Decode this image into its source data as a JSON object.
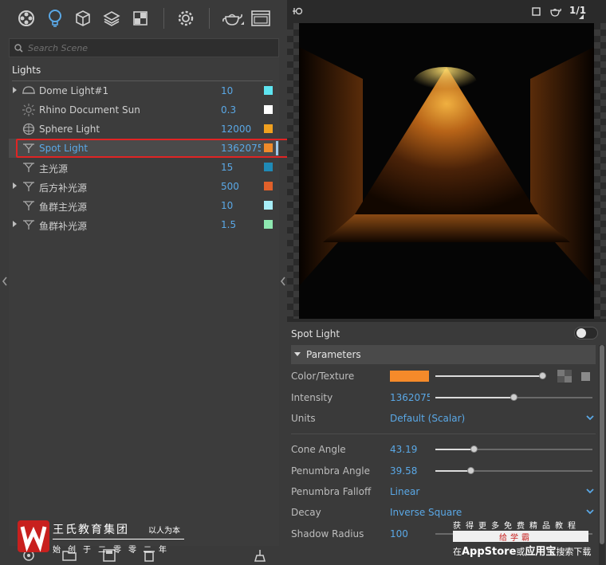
{
  "search": {
    "placeholder": "Search Scene"
  },
  "lights_header": "Lights",
  "lights": [
    {
      "name": "Dome Light#1",
      "value": "10",
      "color": "#5ee4f0",
      "expandable": true,
      "icon": "dome-light-icon"
    },
    {
      "name": "Rhino Document Sun",
      "value": "0.3",
      "color": "#ffffff",
      "expandable": false,
      "icon": "sun-icon"
    },
    {
      "name": "Sphere Light",
      "value": "12000",
      "color": "#f0a020",
      "expandable": false,
      "icon": "sphere-light-icon"
    },
    {
      "name": "Spot Light",
      "value": "1362075",
      "color": "#f08a2a",
      "expandable": false,
      "icon": "spot-light-icon",
      "selected": true
    },
    {
      "name": "主光源",
      "value": "15",
      "color": "#1f8ab6",
      "expandable": false,
      "icon": "spot-light-icon"
    },
    {
      "name": "后方补光源",
      "value": "500",
      "color": "#e0602a",
      "expandable": true,
      "icon": "spot-light-icon"
    },
    {
      "name": "鱼群主光源",
      "value": "10",
      "color": "#a8eef8",
      "expandable": false,
      "icon": "spot-light-icon"
    },
    {
      "name": "鱼群补光源",
      "value": "1.5",
      "color": "#8ee8b0",
      "expandable": true,
      "icon": "spot-light-icon"
    }
  ],
  "render_top": {
    "resolution_label": "1/1"
  },
  "properties": {
    "title": "Spot Light",
    "enabled": false,
    "section": "Parameters",
    "color_texture": {
      "label": "Color/Texture",
      "color": "#f58a2a",
      "slider": 0.98
    },
    "intensity": {
      "label": "Intensity",
      "value": "1362075",
      "slider": 0.5
    },
    "units": {
      "label": "Units",
      "value": "Default (Scalar)"
    },
    "cone_angle": {
      "label": "Cone Angle",
      "value": "43.19",
      "slider": 0.25
    },
    "penumbra_angle": {
      "label": "Penumbra Angle",
      "value": "39.58",
      "slider": 0.23
    },
    "penumbra_falloff": {
      "label": "Penumbra Falloff",
      "value": "Linear"
    },
    "decay": {
      "label": "Decay",
      "value": "Inverse Square"
    },
    "shadow_radius": {
      "label": "Shadow Radius",
      "value": "100"
    }
  },
  "watermark": {
    "brand": "王氏教育集团",
    "slogan": "以人为本",
    "since": "始创于二零零二年",
    "line1": "获得更多免费精品教程",
    "badge": "给学霸",
    "line3_pre": "在",
    "line3_store": "AppStore",
    "line3_mid": "或",
    "line3_app": "应用宝",
    "line3_post": "搜索下载"
  }
}
